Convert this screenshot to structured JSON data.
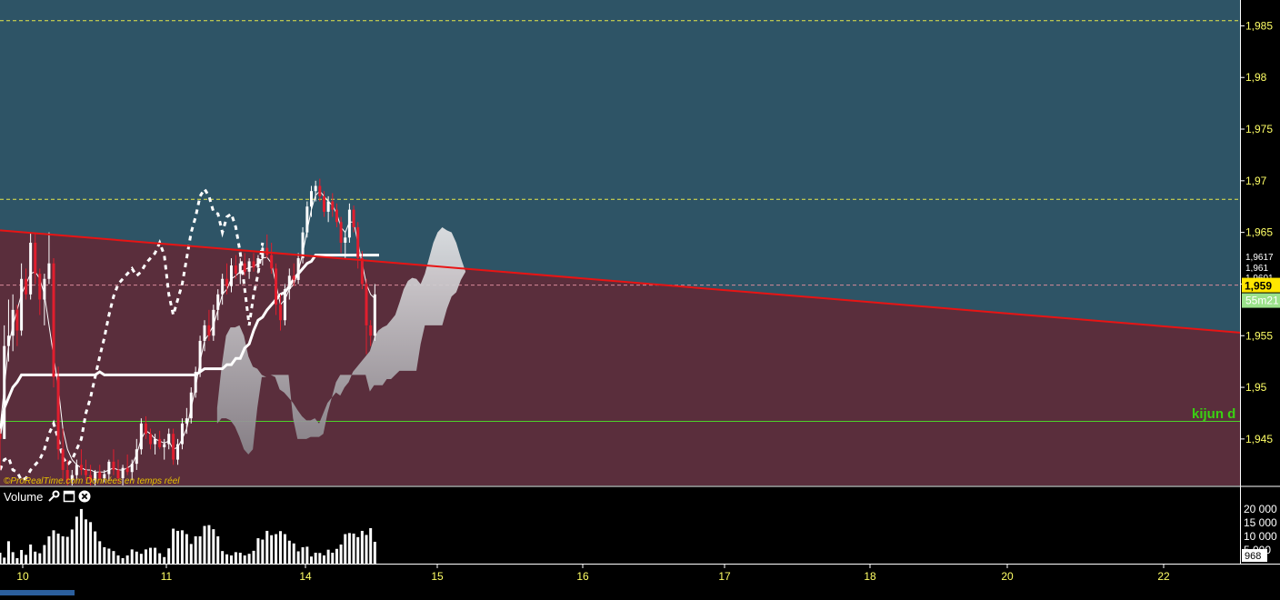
{
  "price_panel": {
    "watermark": "©ProRealTime.com  Données en temps réel",
    "ref_label": "kijun d",
    "current_price": "1,959",
    "price_tags": [
      "1,9617",
      "1,961",
      "1,9601"
    ],
    "timeframe_badge": "55m21"
  },
  "volume_panel": {
    "title": "Volume",
    "current_volume": "968"
  },
  "colors": {
    "bg_top": "#2e5466",
    "bg_bottom": "#5a2e3c",
    "bull": "#ffffff",
    "bear": "#e01e2e",
    "trendline": "#e81414",
    "tick_text": "#ffff66",
    "ref_line": "#4cd12a"
  },
  "chart_data": [
    {
      "type": "line",
      "title": "",
      "y_ticks": [
        "1,985",
        "1,98",
        "1,975",
        "1,97",
        "1,965",
        "1,96",
        "1,955",
        "1,95",
        "1,945"
      ],
      "y_tick_values": [
        1.985,
        1.98,
        1.975,
        1.97,
        1.965,
        1.96,
        1.955,
        1.95,
        1.945
      ],
      "ylim": [
        1.9405,
        1.9875
      ],
      "x_ticks": [
        "10",
        "11",
        "14",
        "15",
        "16",
        "17",
        "18",
        "20",
        "22"
      ],
      "x_tick_days": [
        0,
        1,
        2,
        3,
        4,
        5,
        6,
        7,
        8.1
      ],
      "xlim": [
        -0.17,
        8.58
      ],
      "grid_levels": [
        1.9855,
        1.9682,
        1.9599,
        1.9467
      ],
      "trendline": [
        [
          -0.17,
          1.9652
        ],
        [
          8.58,
          1.9553
        ]
      ],
      "candles": {
        "start_day": -0.17,
        "step_day": 0.0321,
        "ohlc": [
          [
            1.9455,
            1.946,
            1.942,
            1.945
          ],
          [
            1.945,
            1.956,
            1.945,
            1.954
          ],
          [
            1.954,
            1.9585,
            1.9525,
            1.955
          ],
          [
            1.955,
            1.959,
            1.9535,
            1.9575
          ],
          [
            1.9575,
            1.958,
            1.954,
            1.9555
          ],
          [
            1.9555,
            1.962,
            1.955,
            1.9605
          ],
          [
            1.9605,
            1.9615,
            1.9585,
            1.959
          ],
          [
            1.959,
            1.965,
            1.9585,
            1.964
          ],
          [
            1.964,
            1.965,
            1.96,
            1.961
          ],
          [
            1.961,
            1.9615,
            1.957,
            1.9585
          ],
          [
            1.9585,
            1.961,
            1.956,
            1.9605
          ],
          [
            1.9605,
            1.965,
            1.96,
            1.962
          ],
          [
            1.962,
            1.9625,
            1.95,
            1.951
          ],
          [
            1.951,
            1.952,
            1.943,
            1.944
          ],
          [
            1.944,
            1.946,
            1.941,
            1.942
          ],
          [
            1.942,
            1.943,
            1.94,
            1.941
          ],
          [
            1.941,
            1.942,
            1.9405,
            1.9415
          ],
          [
            1.9415,
            1.943,
            1.941,
            1.9425
          ],
          [
            1.9425,
            1.944,
            1.9415,
            1.942
          ],
          [
            1.942,
            1.943,
            1.941,
            1.9415
          ],
          [
            1.9415,
            1.9425,
            1.9405,
            1.941
          ],
          [
            1.941,
            1.942,
            1.9405,
            1.9418
          ],
          [
            1.9418,
            1.9425,
            1.941,
            1.9412
          ],
          [
            1.9412,
            1.942,
            1.9408,
            1.9416
          ],
          [
            1.9416,
            1.943,
            1.941,
            1.9428
          ],
          [
            1.9428,
            1.944,
            1.9415,
            1.942
          ],
          [
            1.942,
            1.943,
            1.9408,
            1.9412
          ],
          [
            1.9412,
            1.9425,
            1.9405,
            1.9422
          ],
          [
            1.9422,
            1.9435,
            1.9415,
            1.9418
          ],
          [
            1.9418,
            1.943,
            1.941,
            1.9426
          ],
          [
            1.9426,
            1.945,
            1.942,
            1.944
          ],
          [
            1.944,
            1.947,
            1.9435,
            1.9465
          ],
          [
            1.9465,
            1.9472,
            1.945,
            1.9455
          ],
          [
            1.9455,
            1.946,
            1.944,
            1.9445
          ],
          [
            1.9445,
            1.9455,
            1.9435,
            1.945
          ],
          [
            1.945,
            1.9458,
            1.944,
            1.9442
          ],
          [
            1.9442,
            1.945,
            1.943,
            1.9445
          ],
          [
            1.9445,
            1.946,
            1.944,
            1.9455
          ],
          [
            1.9455,
            1.946,
            1.9425,
            1.943
          ],
          [
            1.943,
            1.945,
            1.9425,
            1.9445
          ],
          [
            1.9445,
            1.947,
            1.944,
            1.9465
          ],
          [
            1.9465,
            1.948,
            1.9455,
            1.947
          ],
          [
            1.947,
            1.95,
            1.9465,
            1.9495
          ],
          [
            1.9495,
            1.952,
            1.949,
            1.9515
          ],
          [
            1.9515,
            1.955,
            1.951,
            1.9545
          ],
          [
            1.9545,
            1.9565,
            1.9535,
            1.956
          ],
          [
            1.956,
            1.9575,
            1.9545,
            1.955
          ],
          [
            1.955,
            1.958,
            1.9545,
            1.9575
          ],
          [
            1.9575,
            1.9595,
            1.9565,
            1.959
          ],
          [
            1.959,
            1.961,
            1.958,
            1.9605
          ],
          [
            1.9605,
            1.962,
            1.959,
            1.9598
          ],
          [
            1.9598,
            1.9625,
            1.9592,
            1.9618
          ],
          [
            1.9618,
            1.9628,
            1.9605,
            1.961
          ],
          [
            1.961,
            1.9625,
            1.96,
            1.962
          ],
          [
            1.962,
            1.963,
            1.9608,
            1.9612
          ],
          [
            1.9612,
            1.9625,
            1.9605,
            1.9622
          ],
          [
            1.9622,
            1.963,
            1.9612,
            1.9616
          ],
          [
            1.9616,
            1.9628,
            1.961,
            1.9625
          ],
          [
            1.9625,
            1.964,
            1.9618,
            1.9635
          ],
          [
            1.9635,
            1.9648,
            1.9625,
            1.9628
          ],
          [
            1.9628,
            1.964,
            1.961,
            1.9615
          ],
          [
            1.9615,
            1.962,
            1.957,
            1.958
          ],
          [
            1.958,
            1.959,
            1.9555,
            1.9565
          ],
          [
            1.9565,
            1.96,
            1.956,
            1.9595
          ],
          [
            1.9595,
            1.9615,
            1.9585,
            1.9608
          ],
          [
            1.9608,
            1.962,
            1.9598,
            1.9604
          ],
          [
            1.9604,
            1.963,
            1.96,
            1.9625
          ],
          [
            1.9625,
            1.9655,
            1.962,
            1.965
          ],
          [
            1.965,
            1.968,
            1.9645,
            1.9675
          ],
          [
            1.9675,
            1.9695,
            1.9665,
            1.969
          ],
          [
            1.969,
            1.97,
            1.968,
            1.9695
          ],
          [
            1.9695,
            1.9702,
            1.968,
            1.9685
          ],
          [
            1.9685,
            1.969,
            1.9665,
            1.967
          ],
          [
            1.967,
            1.9685,
            1.966,
            1.968
          ],
          [
            1.968,
            1.9688,
            1.9665,
            1.9672
          ],
          [
            1.9672,
            1.9678,
            1.9655,
            1.966
          ],
          [
            1.966,
            1.9665,
            1.963,
            1.964
          ],
          [
            1.964,
            1.965,
            1.9625,
            1.9645
          ],
          [
            1.9645,
            1.9678,
            1.964,
            1.9672
          ],
          [
            1.9672,
            1.9676,
            1.965,
            1.9655
          ],
          [
            1.9655,
            1.966,
            1.9615,
            1.9625
          ],
          [
            1.9625,
            1.9632,
            1.9595,
            1.96
          ],
          [
            1.96,
            1.9605,
            1.9532,
            1.956
          ],
          [
            1.956,
            1.9565,
            1.954,
            1.955
          ],
          [
            1.955,
            1.96,
            1.9545,
            1.959
          ]
        ]
      },
      "series": [
        {
          "style": "solid-thick",
          "start_day": -0.17,
          "step_day": 0.0321,
          "values": [
            1.9455,
            1.948,
            1.949,
            1.95,
            1.9505,
            1.9512,
            1.9512,
            1.9512,
            1.9512,
            1.9512,
            1.9512,
            1.9512,
            1.9512,
            1.9512,
            1.9512,
            1.9512,
            1.9512,
            1.9512,
            1.9512,
            1.9512,
            1.9512,
            1.9512,
            1.9515,
            1.9512,
            1.9512,
            1.9512,
            1.9512,
            1.9512,
            1.9512,
            1.9512,
            1.9512,
            1.9512,
            1.9512,
            1.9512,
            1.9512,
            1.9512,
            1.9512,
            1.9512,
            1.9512,
            1.9512,
            1.9512,
            1.9512,
            1.9512,
            1.9512,
            1.9515,
            1.9518,
            1.9518,
            1.9518,
            1.9518,
            1.9518,
            1.9522,
            1.9522,
            1.9528,
            1.9528,
            1.9538,
            1.9542,
            1.9555,
            1.9565,
            1.9568,
            1.9575,
            1.958,
            1.9585,
            1.959,
            1.9592,
            1.9598,
            1.9605,
            1.961,
            1.9615,
            1.962,
            1.9622,
            1.9628,
            1.9628,
            1.9628,
            1.9628,
            1.9628,
            1.9628,
            1.9628,
            1.9628,
            1.9628,
            1.9628,
            1.9628,
            1.9628,
            1.9628,
            1.9628,
            1.9628,
            1.9628
          ]
        },
        {
          "style": "solid-thin",
          "start_day": -0.17,
          "step_day": 0.0321,
          "values": [
            1.946,
            1.95,
            1.954,
            1.956,
            1.9575,
            1.959,
            1.96,
            1.961,
            1.9612,
            1.9605,
            1.959,
            1.956,
            1.953,
            1.95,
            1.946,
            1.944,
            1.943,
            1.9425,
            1.9422,
            1.942,
            1.942,
            1.9418,
            1.9418,
            1.9418,
            1.942,
            1.9422,
            1.942,
            1.942,
            1.9422,
            1.9425,
            1.9435,
            1.945,
            1.9458,
            1.9455,
            1.945,
            1.9448,
            1.9446,
            1.9448,
            1.944,
            1.9442,
            1.945,
            1.946,
            1.948,
            1.95,
            1.9525,
            1.9545,
            1.9552,
            1.956,
            1.9575,
            1.959,
            1.9595,
            1.9605,
            1.9608,
            1.9612,
            1.9614,
            1.9616,
            1.9617,
            1.962,
            1.9625,
            1.9626,
            1.962,
            1.96,
            1.958,
            1.9585,
            1.9595,
            1.96,
            1.9612,
            1.963,
            1.9652,
            1.9672,
            1.9686,
            1.969,
            1.9685,
            1.968,
            1.9676,
            1.9668,
            1.9655,
            1.965,
            1.966,
            1.966,
            1.964,
            1.962,
            1.96,
            1.959,
            1.9586
          ]
        },
        {
          "style": "dashed",
          "start_day": -0.17,
          "step_day": 0.0321,
          "values": [
            1.942,
            1.943,
            1.9432,
            1.942,
            1.9418,
            1.941,
            1.9412,
            1.942,
            1.9425,
            1.943,
            1.944,
            1.9455,
            1.9465,
            1.945,
            1.9432,
            1.9425,
            1.943,
            1.944,
            1.945,
            1.9475,
            1.949,
            1.951,
            1.953,
            1.9548,
            1.957,
            1.9588,
            1.96,
            1.9605,
            1.961,
            1.9615,
            1.9608,
            1.9612,
            1.962,
            1.9625,
            1.963,
            1.964,
            1.9628,
            1.959,
            1.957,
            1.9585,
            1.96,
            1.9625,
            1.965,
            1.9665,
            1.9685,
            1.9692,
            1.9685,
            1.967,
            1.9668,
            1.965,
            1.9665,
            1.9668,
            1.9655,
            1.963,
            1.9595,
            1.956,
            1.959,
            1.961,
            1.964
          ]
        }
      ],
      "cloud": {
        "start_day": 1.365,
        "step_day": 0.0321,
        "upper": [
          1.948,
          1.952,
          1.955,
          1.9558,
          1.9558,
          1.956,
          1.955,
          1.953,
          1.952,
          1.9518,
          1.9512,
          1.951,
          1.9512,
          1.951,
          1.9498,
          1.9495,
          1.949,
          1.9485,
          1.9478,
          1.9472,
          1.9468,
          1.9468,
          1.947,
          1.9465,
          1.9475,
          1.9485,
          1.949,
          1.9495,
          1.9492,
          1.95,
          1.9505,
          1.9515,
          1.952,
          1.9525,
          1.953,
          1.9535,
          1.9548,
          1.9555,
          1.9558,
          1.956,
          1.9565,
          1.957,
          1.9582,
          1.9595,
          1.9603,
          1.9606,
          1.9605,
          1.96,
          1.961,
          1.9625,
          1.964,
          1.965,
          1.9655,
          1.9652,
          1.965,
          1.964,
          1.9625,
          1.9612
        ],
        "lower": [
          1.9465,
          1.947,
          1.947,
          1.9468,
          1.9462,
          1.9452,
          1.944,
          1.9435,
          1.944,
          1.948,
          1.951,
          1.951,
          1.9512,
          1.9512,
          1.9512,
          1.9512,
          1.9512,
          1.947,
          1.945,
          1.945,
          1.945,
          1.9452,
          1.9452,
          1.9452,
          1.9455,
          1.9475,
          1.949,
          1.9505,
          1.9512,
          1.9512,
          1.9512,
          1.9512,
          1.9512,
          1.9512,
          1.9512,
          1.9496,
          1.9502,
          1.9502,
          1.9502,
          1.9508,
          1.9508,
          1.9512,
          1.9516,
          1.9516,
          1.9516,
          1.9516,
          1.9516,
          1.9542,
          1.956,
          1.956,
          1.956,
          1.956,
          1.956,
          1.9576,
          1.9588,
          1.9592,
          1.9604,
          1.9612
        ]
      }
    },
    {
      "type": "bar",
      "title": "Volume",
      "y_ticks": [
        "20 000",
        "15 000",
        "10 000",
        "5 000"
      ],
      "y_tick_values": [
        20000,
        15000,
        10000,
        5000
      ],
      "ylim": [
        0,
        21300
      ],
      "start_day": -0.17,
      "step_day": 0.0321,
      "values": [
        4000,
        2200,
        8200,
        4200,
        2000,
        5000,
        3200,
        7000,
        4400,
        3800,
        6800,
        10000,
        12200,
        11000,
        10000,
        9800,
        12500,
        17200,
        20000,
        16200,
        15200,
        11800,
        8200,
        6000,
        5500,
        4600,
        3000,
        2000,
        3000,
        5200,
        4400,
        3600,
        5200,
        5800,
        5800,
        3800,
        2400,
        5600,
        12800,
        12000,
        12200,
        10800,
        7200,
        10000,
        10000,
        13800,
        14100,
        12600,
        10000,
        4600,
        3400,
        3000,
        4200,
        4000,
        3000,
        3600,
        4700,
        9300,
        8800,
        12000,
        10400,
        10800,
        11900,
        10800,
        8400,
        7400,
        4500,
        6000,
        6200,
        2600,
        4000,
        3900,
        3000,
        5100,
        4000,
        5400,
        7000,
        10800,
        11200,
        11000,
        9700,
        12000,
        10500,
        13000,
        8000
      ]
    }
  ]
}
